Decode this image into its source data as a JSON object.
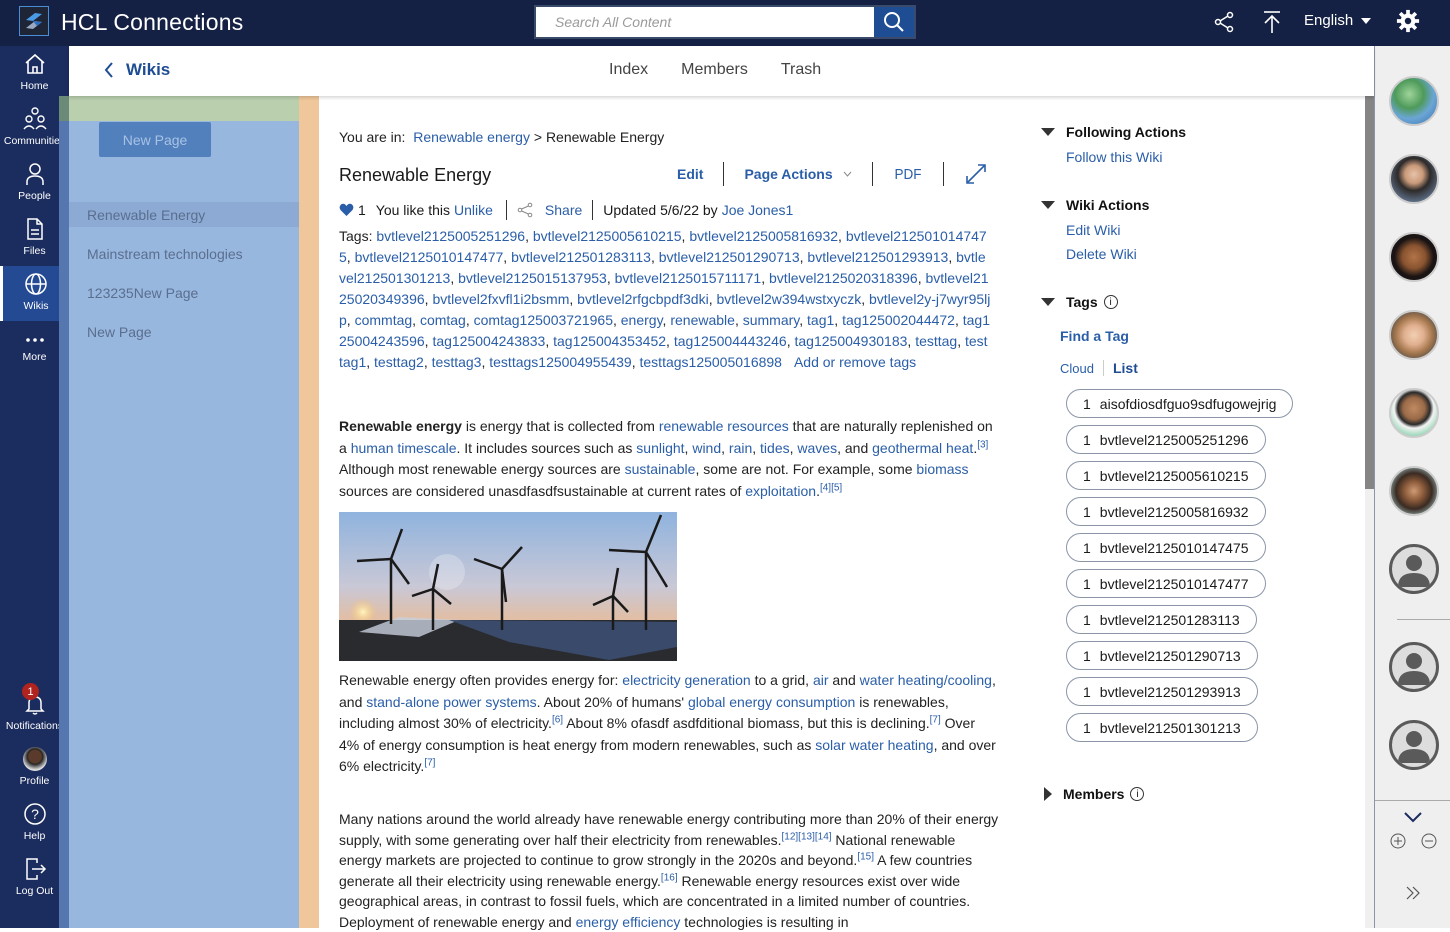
{
  "app": {
    "title": "HCL Connections"
  },
  "search": {
    "placeholder": "Search All Content"
  },
  "topbar": {
    "language": "English"
  },
  "leftnav": {
    "items": [
      {
        "label": "Home",
        "icon": "home-icon"
      },
      {
        "label": "Communities",
        "icon": "communities-icon"
      },
      {
        "label": "People",
        "icon": "people-icon"
      },
      {
        "label": "Files",
        "icon": "files-icon"
      },
      {
        "label": "Wikis",
        "icon": "globe-icon",
        "active": true
      },
      {
        "label": "More",
        "icon": "more-icon"
      }
    ],
    "bottom": [
      {
        "label": "Notifications",
        "icon": "bell-icon",
        "badge": "1"
      },
      {
        "label": "Profile",
        "icon": "avatar"
      },
      {
        "label": "Help",
        "icon": "help-icon"
      },
      {
        "label": "Log Out",
        "icon": "logout-icon"
      }
    ]
  },
  "subnav": {
    "back_label": "Wikis",
    "tabs": [
      "Index",
      "Members",
      "Trash"
    ]
  },
  "sidebar": {
    "new_page": "New Page",
    "pages": [
      "Renewable Energy",
      "Mainstream technologies",
      "123235New Page",
      "New Page"
    ]
  },
  "page": {
    "breadcrumb_prefix": "You are in:",
    "breadcrumb_link": "Renewable energy",
    "breadcrumb_sep": ">",
    "breadcrumb_current": "Renewable Energy",
    "title": "Renewable Energy",
    "actions": {
      "edit": "Edit",
      "page_actions": "Page Actions",
      "pdf": "PDF"
    },
    "likes": "1",
    "like_text": "You like this",
    "unlike": "Unlike",
    "share": "Share",
    "updated": "Updated 5/6/22 by",
    "author": "Joe Jones1",
    "tags_label": "Tags:",
    "tags": [
      "bvtlevel2125005251296",
      "bvtlevel2125005610215",
      "bvtlevel2125005816932",
      "bvtlevel2125010147475",
      "bvtlevel2125010147477",
      "bvtlevel212501283113",
      "bvtlevel212501290713",
      "bvtlevel212501293913",
      "bvtlevel212501301213",
      "bvtlevel2125015137953",
      "bvtlevel2125015711171",
      "bvtlevel2125020318396",
      "bvtlevel2125020349396",
      "bvtlevel2fxvfl1i2bsmm",
      "bvtlevel2rfgcbpdf3dki",
      "bvtlevel2w394wstxyczk",
      "bvtlevel2y-j7wyr95ljp",
      "commtag",
      "comtag",
      "comtag125003721965",
      "energy",
      "renewable",
      "summary",
      "tag1",
      "tag125002044472",
      "tag125004243596",
      "tag125004243833",
      "tag125004353452",
      "tag125004443246",
      "tag125004930183",
      "testtag",
      "testtag1",
      "testtag2",
      "testtag3",
      "testtags125004955439",
      "testtags125005016898"
    ],
    "add_tags": "Add or remove tags",
    "p1": [
      {
        "b": "Renewable energy"
      },
      {
        "t": " is energy that is collected from "
      },
      {
        "a": "renewable resources"
      },
      {
        "t": " that are naturally replenished on a "
      },
      {
        "a": "human timescale"
      },
      {
        "t": ". It includes sources such as "
      },
      {
        "a": "sunlight"
      },
      {
        "t": ", "
      },
      {
        "a": "wind"
      },
      {
        "t": ", "
      },
      {
        "a": "rain"
      },
      {
        "t": ", "
      },
      {
        "a": "tides"
      },
      {
        "t": ", "
      },
      {
        "a": "waves"
      },
      {
        "t": ", and "
      },
      {
        "a": "geothermal heat"
      },
      {
        "t": "."
      },
      {
        "s": "[3]"
      },
      {
        "t": " Although most renewable energy sources are "
      },
      {
        "a": "sustainable"
      },
      {
        "t": ", some are not. For example, some "
      },
      {
        "a": "biomass"
      },
      {
        "t": " sources are considered unasdfasdfsustainable at current rates of "
      },
      {
        "a": "exploitation"
      },
      {
        "t": "."
      },
      {
        "s": "[4][5]"
      }
    ],
    "p2": [
      {
        "t": "Renewable energy often provides energy for: "
      },
      {
        "a": "electricity generation"
      },
      {
        "t": " to a grid, "
      },
      {
        "a": "air"
      },
      {
        "t": " and "
      },
      {
        "a": "water heating/cooling"
      },
      {
        "t": ", and "
      },
      {
        "a": "stand-alone power systems"
      },
      {
        "t": ". About 20% of humans' "
      },
      {
        "a": "global energy consumption"
      },
      {
        "t": " is renewables, including almost 30% of electricity."
      },
      {
        "s": "[6]"
      },
      {
        "t": " About 8% ofasdf asdfditional biomass, but this is declining."
      },
      {
        "s": "[7]"
      },
      {
        "t": " Over 4% of energy consumption is heat energy from modern renewables, such as "
      },
      {
        "a": "solar water heating"
      },
      {
        "t": ", and over 6% electricity."
      },
      {
        "s": "[7]"
      }
    ],
    "p3": [
      {
        "t": "Many nations around the world already have renewable energy contributing more than 20% of their energy supply, with some generating over half their electricity from renewables."
      },
      {
        "s": "[12][13][14]"
      },
      {
        "t": " National renewable energy markets are projected to continue to grow strongly in the 2020s and beyond."
      },
      {
        "s": "[15]"
      },
      {
        "t": " A few countries generate all their electricity using renewable energy."
      },
      {
        "s": "[16]"
      },
      {
        "t": " Renewable energy resources exist over wide geographical areas, in contrast to fossil fuels, which are concentrated in a limited number of countries. Deployment of renewable energy and "
      },
      {
        "a": "energy efficiency"
      },
      {
        "t": " technologies is resulting in"
      }
    ]
  },
  "right": {
    "following_title": "Following Actions",
    "follow": "Follow this Wiki",
    "wiki_actions_title": "Wiki Actions",
    "edit_wiki": "Edit Wiki",
    "delete_wiki": "Delete Wiki",
    "tags_title": "Tags",
    "find_tag": "Find a Tag",
    "cloud": "Cloud",
    "list": "List",
    "tag_list": [
      {
        "count": "1",
        "name": "aisofdiosdfguo9sdfugowejrig"
      },
      {
        "count": "1",
        "name": "bvtlevel2125005251296"
      },
      {
        "count": "1",
        "name": "bvtlevel2125005610215"
      },
      {
        "count": "1",
        "name": "bvtlevel2125005816932"
      },
      {
        "count": "1",
        "name": "bvtlevel2125010147475"
      },
      {
        "count": "1",
        "name": "bvtlevel2125010147477"
      },
      {
        "count": "1",
        "name": "bvtlevel212501283113"
      },
      {
        "count": "1",
        "name": "bvtlevel212501290713"
      },
      {
        "count": "1",
        "name": "bvtlevel212501293913"
      },
      {
        "count": "1",
        "name": "bvtlevel212501301213"
      }
    ],
    "members_title": "Members"
  },
  "colors": {
    "nav": "#1b2c5e",
    "topbar": "#152144",
    "link": "#2a5ea8",
    "accent": "#1f4d94"
  }
}
